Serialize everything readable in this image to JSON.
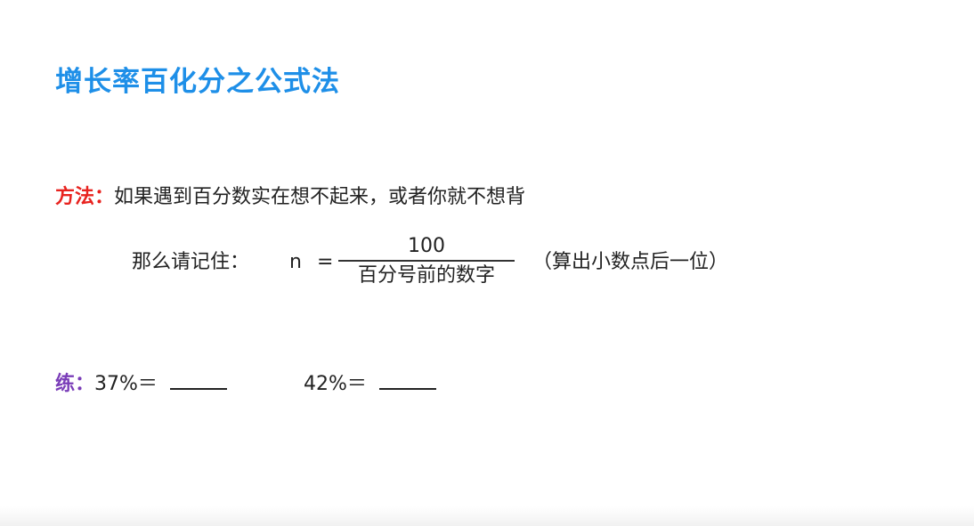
{
  "slide": {
    "title": "增长率百化分之公式法",
    "method": {
      "label": "方法：",
      "text": "如果遇到百分数实在想不起来，或者你就不想背"
    },
    "remember": {
      "text": "那么请记住：",
      "variable": "n",
      "equals": "=",
      "numerator": "100",
      "denominator": "百分号前的数字",
      "hint": "（算出小数点后一位）"
    },
    "practice": {
      "label": "练：",
      "items": [
        {
          "expr": "37%＝"
        },
        {
          "expr": "42%＝"
        }
      ]
    },
    "colors": {
      "title": "#1e8fe8",
      "method_label": "#e8231f",
      "practice_label": "#7a3db8"
    }
  }
}
